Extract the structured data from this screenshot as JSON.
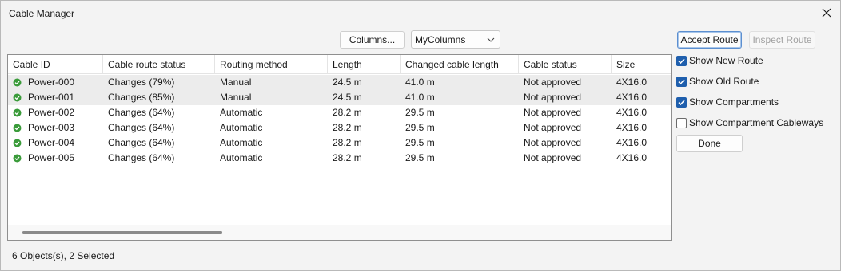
{
  "window": {
    "title": "Cable Manager"
  },
  "toolbar": {
    "columns_label": "Columns...",
    "column_set": "MyColumns"
  },
  "table": {
    "headers": [
      "Cable ID",
      "Cable route status",
      "Routing method",
      "Length",
      "Changed cable length",
      "Cable status",
      "Size"
    ],
    "rows": [
      {
        "id": "Power-000",
        "route_status": "Changes (79%)",
        "method": "Manual",
        "length": "24.5 m",
        "changed_length": "41.0 m",
        "cable_status": "Not approved",
        "size": "4X16.0",
        "selected": true
      },
      {
        "id": "Power-001",
        "route_status": "Changes (85%)",
        "method": "Manual",
        "length": "24.5 m",
        "changed_length": "41.0 m",
        "cable_status": "Not approved",
        "size": "4X16.0",
        "selected": true
      },
      {
        "id": "Power-002",
        "route_status": "Changes (64%)",
        "method": "Automatic",
        "length": "28.2 m",
        "changed_length": "29.5 m",
        "cable_status": "Not approved",
        "size": "4X16.0",
        "selected": false
      },
      {
        "id": "Power-003",
        "route_status": "Changes (64%)",
        "method": "Automatic",
        "length": "28.2 m",
        "changed_length": "29.5 m",
        "cable_status": "Not approved",
        "size": "4X16.0",
        "selected": false
      },
      {
        "id": "Power-004",
        "route_status": "Changes (64%)",
        "method": "Automatic",
        "length": "28.2 m",
        "changed_length": "29.5 m",
        "cable_status": "Not approved",
        "size": "4X16.0",
        "selected": false
      },
      {
        "id": "Power-005",
        "route_status": "Changes (64%)",
        "method": "Automatic",
        "length": "28.2 m",
        "changed_length": "29.5 m",
        "cable_status": "Not approved",
        "size": "4X16.0",
        "selected": false
      }
    ]
  },
  "side_panel": {
    "accept_route_label": "Accept Route",
    "inspect_route_label": "Inspect Route",
    "options": [
      {
        "label": "Show New Route",
        "checked": true
      },
      {
        "label": "Show Old Route",
        "checked": true
      },
      {
        "label": "Show Compartments",
        "checked": true
      },
      {
        "label": "Show Compartment Cableways",
        "checked": false
      }
    ],
    "done_label": "Done"
  },
  "status_bar": {
    "text": "6 Objects(s), 2 Selected"
  },
  "icons": {
    "close": "close-icon",
    "chevron": "chevron-down-icon",
    "row_status": "check-circle-icon"
  },
  "colors": {
    "status_ok": "#3a9b3a",
    "checkbox_on": "#1f5fad",
    "selected_row": "#ececec",
    "primary_border": "#5c8fd0"
  }
}
